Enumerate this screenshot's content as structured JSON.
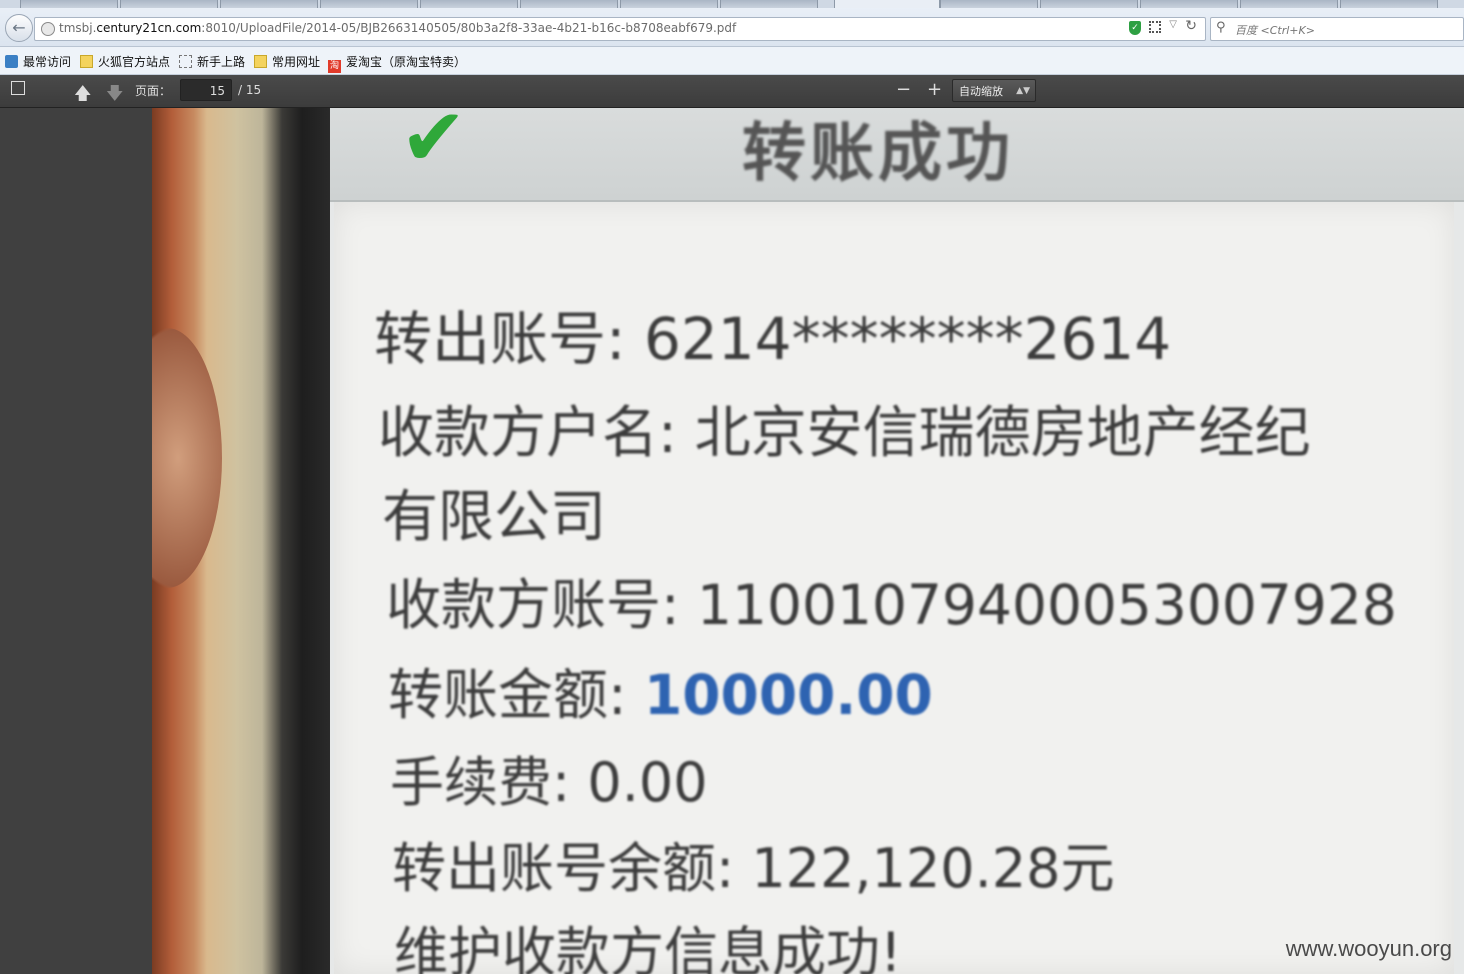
{
  "browser": {
    "url_prefix": "tmsbj.",
    "url_host": "century21cn.com",
    "url_rest": ":8010/UploadFile/2014-05/BJB2663140505/80b3a2f8-33ae-4b21-b16c-b8708eabf679.pdf",
    "search_placeholder": "百度 <Ctrl+K>"
  },
  "bookmarks": [
    {
      "label": "最常访问",
      "icon": "star-icon"
    },
    {
      "label": "火狐官方站点",
      "icon": "folder-icon"
    },
    {
      "label": "新手上路",
      "icon": "dashed-folder-icon"
    },
    {
      "label": "常用网址",
      "icon": "folder-icon"
    },
    {
      "label": "爱淘宝（原淘宝特卖）",
      "icon": "taobao-icon"
    }
  ],
  "pdf_toolbar": {
    "page_label": "页面：",
    "page_current": "15",
    "page_total": "/ 15",
    "zoom_value": "自动缩放"
  },
  "receipt": {
    "title": "转账成功",
    "lines": [
      "转出账号: 6214********2614",
      "收款方户名: 北京安信瑞德房地产经纪",
      "有限公司",
      "收款方账号: 11001079400053007928",
      "转账金额: ",
      "手续费: 0.00",
      "转出账号余额: 122,120.28元",
      "维护收款方信息成功!"
    ],
    "amount": "10000.00"
  },
  "watermark": "www.wooyun.org"
}
